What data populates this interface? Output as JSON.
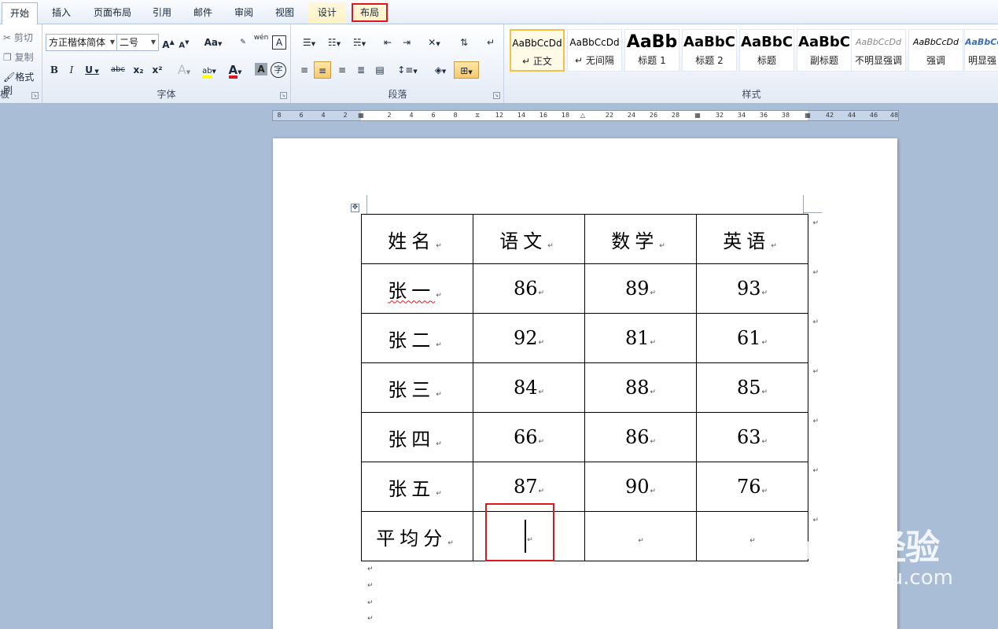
{
  "tabs": [
    "开始",
    "插入",
    "页面布局",
    "引用",
    "邮件",
    "审阅",
    "视图",
    "设计",
    "布局"
  ],
  "clipboard": {
    "items": [
      "剪切",
      "复制",
      "格式刷"
    ],
    "label_fragment": "板"
  },
  "font_group": {
    "font_name": "方正楷体简体",
    "font_size": "二号",
    "label": "字体",
    "grow": "A",
    "shrink": "A",
    "case": "Aa",
    "bold": "B",
    "italic": "I",
    "underline": "U",
    "strike": "abc",
    "subscript": "x₂",
    "superscript": "x²",
    "font_color": "A",
    "char_border": "A",
    "enclose": "字",
    "phonetic": "wén",
    "highlight": "ab"
  },
  "paragraph_group": {
    "label": "段落"
  },
  "styles_group": {
    "label": "样式",
    "items": [
      {
        "sample": "AaBbCcDd",
        "name": "正文"
      },
      {
        "sample": "AaBbCcDd",
        "name": "无间隔"
      },
      {
        "sample": "AaBb",
        "name": "标题 1"
      },
      {
        "sample": "AaBbC",
        "name": "标题 2"
      },
      {
        "sample": "AaBbC",
        "name": "标题"
      },
      {
        "sample": "AaBbC",
        "name": "副标题"
      },
      {
        "sample": "AaBbCcDd",
        "name": "不明显强调"
      },
      {
        "sample": "AaBbCcDd",
        "name": "强调"
      },
      {
        "sample": "AaBbCcDd",
        "name": "明显强"
      }
    ]
  },
  "ruler_labels": [
    "8",
    "6",
    "4",
    "2",
    "2",
    "4",
    "6",
    "8",
    "12",
    "14",
    "16",
    "18",
    "22",
    "24",
    "26",
    "28",
    "32",
    "34",
    "36",
    "38",
    "42",
    "44",
    "46",
    "48"
  ],
  "table": {
    "headers": [
      "姓名",
      "语文",
      "数学",
      "英语"
    ],
    "rows": [
      [
        "张一",
        "86",
        "89",
        "93"
      ],
      [
        "张二",
        "92",
        "81",
        "61"
      ],
      [
        "张三",
        "84",
        "88",
        "85"
      ],
      [
        "张四",
        "66",
        "86",
        "63"
      ],
      [
        "张五",
        "87",
        "90",
        "76"
      ],
      [
        "平均分",
        "",
        "",
        ""
      ]
    ]
  },
  "watermark": {
    "logo": "Baidu经验",
    "url": "jingyan.baidu.com"
  },
  "colors": {
    "highlight_box": "#e0151e",
    "ribbon_bg": "#eef3fa",
    "workspace_bg": "#a9bdd6"
  }
}
